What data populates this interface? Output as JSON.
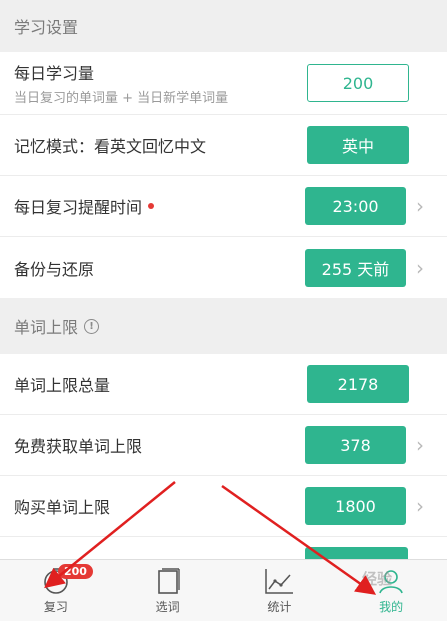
{
  "sections": {
    "study": {
      "title": "学习设置"
    },
    "limit": {
      "title": "单词上限"
    }
  },
  "rows": {
    "daily": {
      "label": "每日学习量",
      "sub": "当日复习的单词量 + 当日新学单词量",
      "value": "200"
    },
    "memory": {
      "label": "记忆模式：看英文回忆中文",
      "value": "英中"
    },
    "reminder": {
      "label": "每日复习提醒时间",
      "value": "23:00"
    },
    "backup": {
      "label": "备份与还原",
      "value": "255 天前"
    },
    "total": {
      "label": "单词上限总量",
      "value": "2178"
    },
    "free": {
      "label": "免费获取单词上限",
      "value": "378"
    },
    "buy": {
      "label": "购买单词上限",
      "value": "1800"
    }
  },
  "tabs": [
    {
      "label": "复习",
      "icon": "stopwatch-icon",
      "badge": "200"
    },
    {
      "label": "选词",
      "icon": "cards-icon"
    },
    {
      "label": "统计",
      "icon": "chart-icon"
    },
    {
      "label": "我的",
      "icon": "profile-icon"
    }
  ],
  "watermark": "经验",
  "colors": {
    "accent": "#2fb58f",
    "badge": "#e53935",
    "arrow": "#e02020"
  }
}
